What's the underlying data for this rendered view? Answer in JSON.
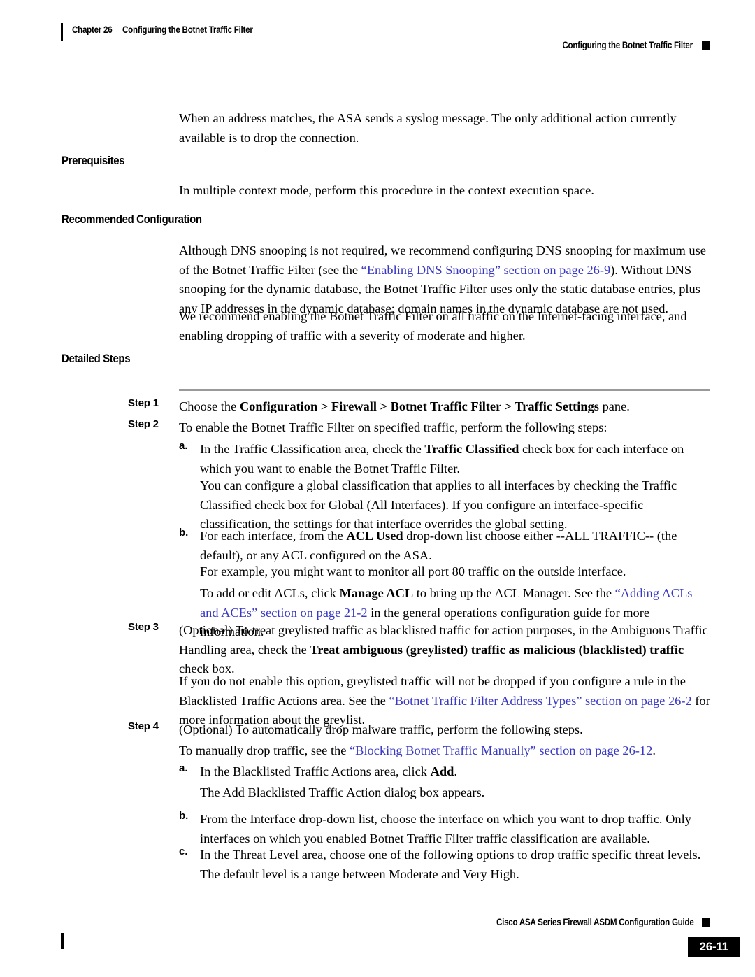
{
  "header": {
    "chapter_label": "Chapter 26",
    "chapter_title": "Configuring the Botnet Traffic Filter",
    "running_head": "Configuring the Botnet Traffic Filter"
  },
  "footer": {
    "guide_title": "Cisco ASA Series Firewall ASDM Configuration Guide",
    "page_number": "26-11"
  },
  "colors": {
    "link": "#3838c4",
    "rule_gray": "#999999",
    "text": "#000000"
  },
  "intro_paragraph": "When an address matches, the ASA sends a syslog message. The only additional action currently available is to drop the connection.",
  "sections": {
    "prerequisites": {
      "heading": "Prerequisites",
      "paragraph": "In multiple context mode, perform this procedure in the context execution space."
    },
    "recommended_configuration": {
      "heading": "Recommended Configuration",
      "paragraph1_a": "Although DNS snooping is not required, we recommend configuring DNS snooping for maximum use of the Botnet Traffic Filter (see the ",
      "paragraph1_link": "“Enabling DNS Snooping” section on page 26-9",
      "paragraph1_b": "). Without DNS snooping for the dynamic database, the Botnet Traffic Filter uses only the static database entries, plus any IP addresses in the dynamic database; domain names in the dynamic database are not used.",
      "paragraph2": "We recommend enabling the Botnet Traffic Filter on all traffic on the Internet-facing interface, and enabling dropping of traffic with a severity of moderate and higher."
    },
    "detailed_steps": {
      "heading": "Detailed Steps"
    }
  },
  "steps": {
    "step1": {
      "label": "Step 1",
      "text_a": "Choose the ",
      "bold": "Configuration > Firewall > Botnet Traffic Filter > Traffic Settings",
      "text_b": " pane."
    },
    "step2": {
      "label": "Step 2",
      "text": "To enable the Botnet Traffic Filter on specified traffic, perform the following steps:",
      "sub_a": {
        "label": "a.",
        "text_a": "In the Traffic Classification area, check the ",
        "bold": "Traffic Classified",
        "text_b": " check box for each interface on which you want to enable the Botnet Traffic Filter.",
        "para2": "You can configure a global classification that applies to all interfaces by checking the Traffic Classified check box for Global (All Interfaces). If you configure an interface-specific classification, the settings for that interface overrides the global setting."
      },
      "sub_b": {
        "label": "b.",
        "text_a": "For each interface, from the ",
        "bold": "ACL Used",
        "text_b": " drop-down list choose either --ALL TRAFFIC-- (the default), or any ACL configured on the ASA.",
        "para2": "For example, you might want to monitor all port 80 traffic on the outside interface.",
        "para3_a": "To add or edit ACLs, click ",
        "para3_bold": "Manage ACL",
        "para3_b": " to bring up the ACL Manager. See the ",
        "para3_link": "“Adding ACLs and ACEs” section on page 21-2",
        "para3_c": " in the general operations configuration guide for more information."
      }
    },
    "step3": {
      "label": "Step 3",
      "text_a": "(Optional) To treat greylisted traffic as blacklisted traffic for action purposes, in the Ambiguous Traffic Handling area, check the ",
      "bold": "Treat ambiguous (greylisted) traffic as malicious (blacklisted) traffic",
      "text_b": " check box.",
      "para2_a": "If you do not enable this option, greylisted traffic will not be dropped if you configure a rule in the Blacklisted Traffic Actions area. See the ",
      "para2_link": "“Botnet Traffic Filter Address Types” section on page 26-2",
      "para2_b": " for more information about the greylist."
    },
    "step4": {
      "label": "Step 4",
      "text": "(Optional) To automatically drop malware traffic, perform the following steps.",
      "para2_a": "To manually drop traffic, see the ",
      "para2_link": "“Blocking Botnet Traffic Manually” section on page 26-12",
      "para2_b": ".",
      "sub_a": {
        "label": "a.",
        "text_a": "In the Blacklisted Traffic Actions area, click ",
        "bold": "Add",
        "text_b": ".",
        "para2": "The Add Blacklisted Traffic Action dialog box appears."
      },
      "sub_b": {
        "label": "b.",
        "text": "From the Interface drop-down list, choose the interface on which you want to drop traffic. Only interfaces on which you enabled Botnet Traffic Filter traffic classification are available."
      },
      "sub_c": {
        "label": "c.",
        "text": "In the Threat Level area, choose one of the following options to drop traffic specific threat levels. The default level is a range between Moderate and Very High."
      }
    }
  }
}
